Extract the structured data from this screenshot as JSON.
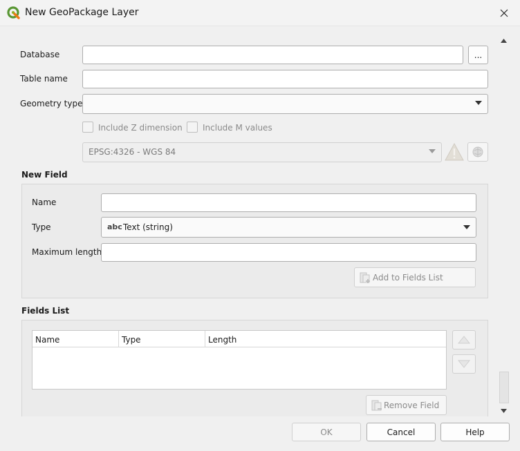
{
  "window": {
    "title": "New GeoPackage Layer"
  },
  "form": {
    "database_label": "Database",
    "database_value": "",
    "browse_label": "...",
    "table_name_label": "Table name",
    "table_name_value": "",
    "geometry_type_label": "Geometry type",
    "geometry_type_value": "",
    "include_z_label": "Include Z dimension",
    "include_m_label": "Include M values",
    "crs_value": "EPSG:4326 - WGS 84"
  },
  "new_field": {
    "title": "New Field",
    "name_label": "Name",
    "name_value": "",
    "type_label": "Type",
    "type_abc": "abc",
    "type_value": "Text (string)",
    "max_length_label": "Maximum length",
    "max_length_value": "",
    "add_button": "Add to Fields List"
  },
  "fields_list": {
    "title": "Fields List",
    "columns": [
      "Name",
      "Type",
      "Length"
    ],
    "rows": [],
    "remove_button": "Remove Field"
  },
  "footer": {
    "ok": "OK",
    "cancel": "Cancel",
    "help": "Help"
  }
}
